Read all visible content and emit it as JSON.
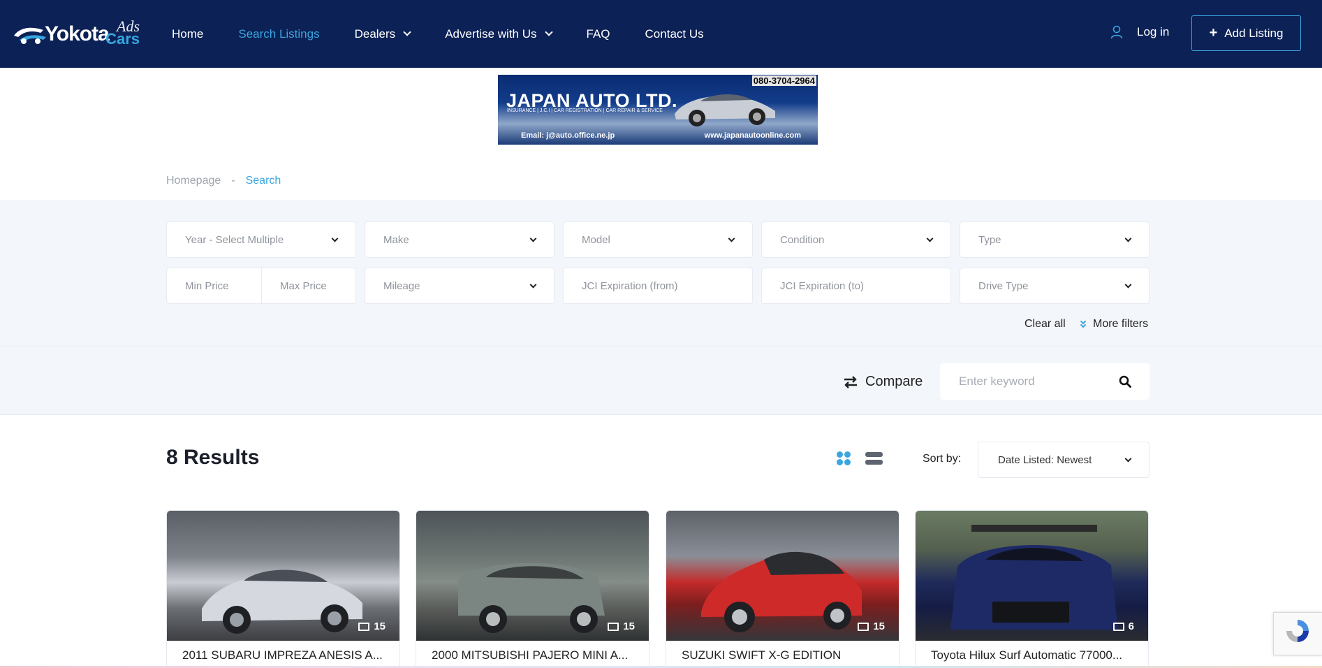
{
  "header": {
    "logo": {
      "brand": "Yokota",
      "sub_top": "Ads",
      "sub_bottom": "Cars"
    },
    "nav": [
      {
        "label": "Home",
        "active": false,
        "dropdown": false
      },
      {
        "label": "Search Listings",
        "active": true,
        "dropdown": false
      },
      {
        "label": "Dealers",
        "active": false,
        "dropdown": true
      },
      {
        "label": "Advertise with Us",
        "active": false,
        "dropdown": true
      },
      {
        "label": "FAQ",
        "active": false,
        "dropdown": false
      },
      {
        "label": "Contact Us",
        "active": false,
        "dropdown": false
      }
    ],
    "login_label": "Log in",
    "add_listing_label": "Add Listing",
    "colors": {
      "navbar": "#0c2155",
      "accent": "#3aa6e0"
    }
  },
  "banner": {
    "title": "JAPAN AUTO LTD.",
    "subtitle": "INSURANCE | J.C.I | CAR REGISTRATION | CAR REPAIR & SERVICE",
    "phone": "080-3704-2964",
    "email": "Email: j@auto.office.ne.jp",
    "website": "www.japanautoonline.com"
  },
  "breadcrumb": {
    "home": "Homepage",
    "separator": "-",
    "current": "Search"
  },
  "filters": {
    "year": "Year - Select Multiple",
    "make": "Make",
    "model": "Model",
    "condition": "Condition",
    "type": "Type",
    "min_price": "Min Price",
    "max_price": "Max Price",
    "mileage": "Mileage",
    "jci_from": "JCI Expiration (from)",
    "jci_to": "JCI Expiration (to)",
    "drive_type": "Drive Type",
    "clear_all": "Clear all",
    "more_filters": "More filters"
  },
  "toolbar": {
    "compare_label": "Compare",
    "search_placeholder": "Enter keyword"
  },
  "results": {
    "title": "8 Results",
    "sort_label": "Sort by:",
    "sort_value": "Date Listed: Newest",
    "view_mode": "grid"
  },
  "listings": [
    {
      "title": "2011 SUBARU IMPREZA ANESIS A...",
      "photos": "15"
    },
    {
      "title": "2000 MITSUBISHI PAJERO MINI A...",
      "photos": "15"
    },
    {
      "title": "SUZUKI SWIFT X-G EDITION",
      "photos": "15"
    },
    {
      "title": "Toyota Hilux Surf Automatic 77000...",
      "photos": "6"
    }
  ]
}
